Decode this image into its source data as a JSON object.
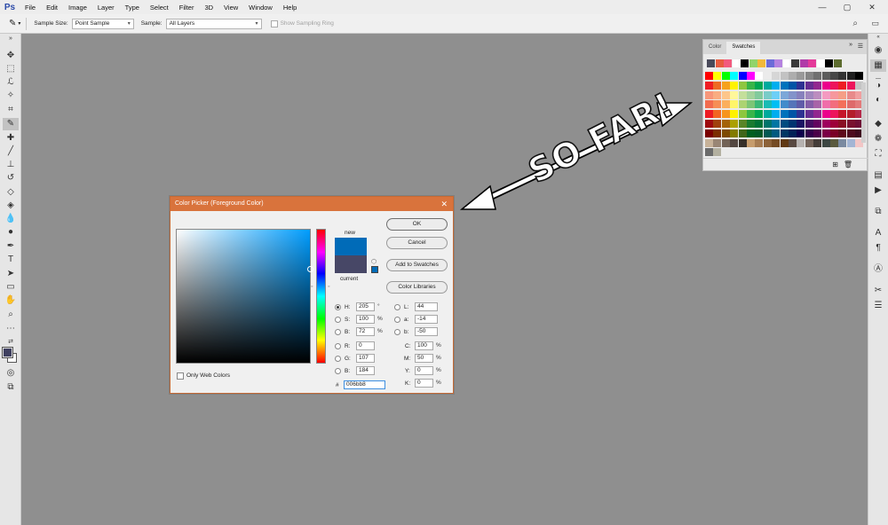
{
  "app": {
    "logo": "Ps"
  },
  "menu": [
    "File",
    "Edit",
    "Image",
    "Layer",
    "Type",
    "Select",
    "Filter",
    "3D",
    "View",
    "Window",
    "Help"
  ],
  "window_controls": {
    "minimize": "—",
    "maximize": "▢",
    "close": "✕"
  },
  "options": {
    "sample_size_label": "Sample Size:",
    "sample_size_value": "Point Sample",
    "sample_label": "Sample:",
    "sample_value": "All Layers",
    "sampling_ring_label": "Show Sampling Ring"
  },
  "swatches_panel": {
    "tabs": [
      "Color",
      "Swatches"
    ],
    "active_tab": "Swatches",
    "recent_colors": [
      "#4a4a5a",
      "#e85c40",
      "#f25a7e",
      "#ffffff",
      "#000000",
      "#91d46a",
      "#f2b93a",
      "#6b6bd8",
      "#b582e0",
      "#ffffff",
      "#3a3a3a",
      "#b03aa8",
      "#e43a9a",
      "#ffffff",
      "#000000",
      "#5c6b2e"
    ],
    "rows": [
      [
        "#ff0000",
        "#ffff00",
        "#00ff00",
        "#00ffff",
        "#0000ff",
        "#ff00ff",
        "#ffffff",
        "#ebebeb",
        "#d6d6d6",
        "#c2c2c2",
        "#adadad",
        "#999999",
        "#858585",
        "#707070",
        "#5c5c5c",
        "#474747",
        "#333333",
        "#1f1f1f",
        "#000000"
      ],
      [
        "#ee1d24",
        "#ee6a24",
        "#f6a11c",
        "#fff200",
        "#8ec641",
        "#38b449",
        "#00a651",
        "#00a99d",
        "#00aeef",
        "#0072bc",
        "#0054a6",
        "#2e3192",
        "#662d91",
        "#92278f",
        "#ec008c",
        "#ed145b",
        "#ee1d24",
        "#ed145b",
        "#c4c4c4"
      ],
      [
        "#f7977a",
        "#f9ad81",
        "#fdc68a",
        "#fff79a",
        "#c4df9b",
        "#a3d39c",
        "#82ca9d",
        "#7accc8",
        "#6dcff6",
        "#7da7d8",
        "#8393ca",
        "#8781bd",
        "#a187be",
        "#bc8dbf",
        "#f49ac1",
        "#f6989d",
        "#f59e86",
        "#e88a8a",
        "#f0a0a0"
      ],
      [
        "#f26c4f",
        "#f68e56",
        "#fbaf5d",
        "#fff568",
        "#acd372",
        "#7cc576",
        "#3bb878",
        "#1abbb4",
        "#00bff3",
        "#438ccb",
        "#5574b9",
        "#605ca8",
        "#855fa8",
        "#a864a8",
        "#f06eaa",
        "#f26d7d",
        "#f36f5a",
        "#de6a6a",
        "#e37b7b"
      ],
      [
        "#ed1c24",
        "#f26522",
        "#f7941d",
        "#fff200",
        "#8dc73f",
        "#39b54a",
        "#00a651",
        "#00a99d",
        "#00aeef",
        "#0072bc",
        "#0054a6",
        "#2e3192",
        "#662d91",
        "#92278f",
        "#ec008c",
        "#ed145b",
        "#c6162a",
        "#b41d2c",
        "#b52a4a"
      ],
      [
        "#9e0b0f",
        "#a0410d",
        "#a36209",
        "#aba000",
        "#598527",
        "#1a7b30",
        "#007236",
        "#00746b",
        "#0076a3",
        "#004b80",
        "#003471",
        "#1b1464",
        "#440e62",
        "#630460",
        "#9e005d",
        "#9e0039",
        "#8a0f23",
        "#7a1130",
        "#6f0f36"
      ],
      [
        "#790000",
        "#7b2e00",
        "#7d4900",
        "#827b00",
        "#406618",
        "#005e20",
        "#005826",
        "#005952",
        "#005b7f",
        "#003663",
        "#002157",
        "#0d004c",
        "#32004b",
        "#4b0049",
        "#7b0046",
        "#7a0026",
        "#5e0a1b",
        "#4e0b1f",
        "#3e0a1e"
      ],
      [
        "#c7b299",
        "#998675",
        "#736357",
        "#534741",
        "#37302a",
        "#c69c6d",
        "#a67c52",
        "#8c6239",
        "#754c24",
        "#603913",
        "#594a42",
        "#b6b2b0",
        "#716158",
        "#443c38",
        "#3d4743",
        "#5a5a3e",
        "#7a8aa0",
        "#a3b5d4",
        "#f2c6c6"
      ]
    ],
    "tail_colors": [
      "#6b6b6b",
      "#b3b0a0"
    ]
  },
  "dialog": {
    "title": "Color Picker (Foreground Color)",
    "close": "✕",
    "new_label": "new",
    "current_label": "current",
    "new_color": "#006bb8",
    "current_color": "#474766",
    "buttons": {
      "ok": "OK",
      "cancel": "Cancel",
      "add_to_swatches": "Add to Swatches",
      "color_libraries": "Color Libraries"
    },
    "only_web_colors": "Only Web Colors",
    "hsb": [
      {
        "label": "H:",
        "value": "205",
        "unit": "°"
      },
      {
        "label": "S:",
        "value": "100",
        "unit": "%"
      },
      {
        "label": "B:",
        "value": "72",
        "unit": "%"
      }
    ],
    "rgb": [
      {
        "label": "R:",
        "value": "0"
      },
      {
        "label": "G:",
        "value": "107"
      },
      {
        "label": "B:",
        "value": "184"
      }
    ],
    "lab": [
      {
        "label": "L:",
        "value": "44"
      },
      {
        "label": "a:",
        "value": "-14"
      },
      {
        "label": "b:",
        "value": "-50"
      }
    ],
    "cmyk": [
      {
        "label": "C:",
        "value": "100",
        "unit": "%"
      },
      {
        "label": "M:",
        "value": "50",
        "unit": "%"
      },
      {
        "label": "Y:",
        "value": "0",
        "unit": "%"
      },
      {
        "label": "K:",
        "value": "0",
        "unit": "%"
      }
    ],
    "hex_label": "#",
    "hex_value": "006bb8"
  },
  "annotation": {
    "text": "SO FAR!",
    "color": "#ffffff"
  },
  "accent": {
    "dialog_title_bg": "#d9733c"
  }
}
